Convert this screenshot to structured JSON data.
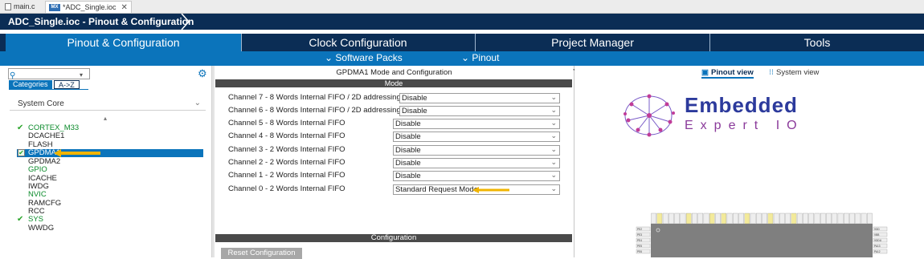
{
  "editor_tabs": [
    {
      "label": "main.c"
    },
    {
      "label": "*ADC_Single.ioc",
      "icon_text": "MX"
    }
  ],
  "breadcrumb": "ADC_Single.ioc - Pinout & Configuration",
  "main_tabs": [
    {
      "label": "Pinout & Configuration",
      "active": true
    },
    {
      "label": "Clock Configuration"
    },
    {
      "label": "Project Manager"
    },
    {
      "label": "Tools"
    }
  ],
  "sub_menu": {
    "software_packs": "Software Packs",
    "pinout": "Pinout"
  },
  "left_panel": {
    "search_value": "",
    "category_tabs": {
      "categories": "Categories",
      "az": "A->Z"
    },
    "group_select": "System Core",
    "items": [
      {
        "label": "CORTEX_M33",
        "checked": true,
        "green": true
      },
      {
        "label": "DCACHE1"
      },
      {
        "label": "FLASH"
      },
      {
        "label": "GPDMA1",
        "checked": true,
        "selected": true
      },
      {
        "label": "GPDMA2"
      },
      {
        "label": "GPIO",
        "green": true
      },
      {
        "label": "ICACHE"
      },
      {
        "label": "IWDG"
      },
      {
        "label": "NVIC",
        "green": true
      },
      {
        "label": "RAMCFG"
      },
      {
        "label": "RCC"
      },
      {
        "label": "SYS",
        "checked": true,
        "green": true
      },
      {
        "label": "WWDG"
      }
    ]
  },
  "middle_panel": {
    "title": "GPDMA1 Mode and Configuration",
    "mode_header": "Mode",
    "channels": [
      {
        "label": "Channel 7  - 8 Words Internal FIFO / 2D addressing",
        "value": "Disable"
      },
      {
        "label": "Channel 6  - 8 Words Internal FIFO / 2D addressing",
        "value": "Disable"
      },
      {
        "label": "Channel 5  - 8 Words Internal FIFO",
        "value": "Disable"
      },
      {
        "label": "Channel 4  - 8 Words Internal FIFO",
        "value": "Disable"
      },
      {
        "label": "Channel 3  - 2 Words Internal FIFO",
        "value": "Disable"
      },
      {
        "label": "Channel 2  - 2 Words Internal FIFO",
        "value": "Disable"
      },
      {
        "label": "Channel 1  - 2 Words Internal FIFO",
        "value": "Disable"
      },
      {
        "label": "Channel 0  - 2 Words Internal FIFO",
        "value": "Standard Request Mode"
      }
    ],
    "configuration_header": "Configuration",
    "reset_button": "Reset Configuration"
  },
  "right_panel": {
    "pinout_view": "Pinout view",
    "system_view": "System view",
    "logo_line1": "Embedded",
    "logo_line2": "Expert IO",
    "chip_pins_left": [
      "PE2",
      "PE3",
      "PE4",
      "PE5",
      "PE6"
    ],
    "chip_pins_right": [
      "VDD",
      "VBB",
      "VDDU",
      "PA13",
      "PA12"
    ]
  },
  "colors": {
    "navy": "#0b2d55",
    "accent_blue": "#0b74bb",
    "green_check": "#2aa52a",
    "annotation_arrow": "#f0b400"
  }
}
